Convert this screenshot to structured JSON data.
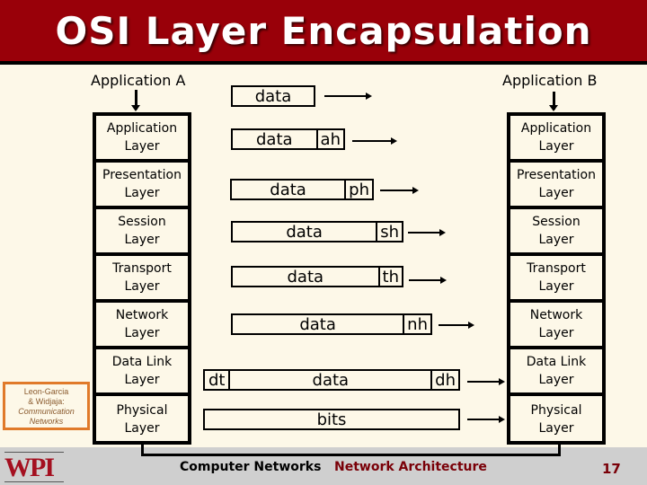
{
  "slide": {
    "title": "OSI Layer Encapsulation",
    "colors": {
      "title_bar": "#990009",
      "background": "#fdf8e8",
      "footer": "#cfcfcf",
      "credit_border": "#e07a2a",
      "accent_text": "#7a0008"
    }
  },
  "diagram": {
    "sender_label": "Application A",
    "receiver_label": "Application B",
    "layers": [
      {
        "line1": "Application",
        "line2": "Layer"
      },
      {
        "line1": "Presentation",
        "line2": "Layer"
      },
      {
        "line1": "Session",
        "line2": "Layer"
      },
      {
        "line1": "Transport",
        "line2": "Layer"
      },
      {
        "line1": "Network",
        "line2": "Layer"
      },
      {
        "line1": "Data Link",
        "line2": "Layer"
      },
      {
        "line1": "Physical",
        "line2": "Layer"
      }
    ],
    "pdus": [
      {
        "body": "data",
        "header": "",
        "trailer": ""
      },
      {
        "body": "data",
        "header": "ah",
        "trailer": ""
      },
      {
        "body": "data",
        "header": "ph",
        "trailer": ""
      },
      {
        "body": "data",
        "header": "sh",
        "trailer": ""
      },
      {
        "body": "data",
        "header": "th",
        "trailer": ""
      },
      {
        "body": "data",
        "header": "nh",
        "trailer": ""
      },
      {
        "body": "data",
        "header": "dh",
        "trailer": "dt"
      },
      {
        "body": "bits",
        "header": "",
        "trailer": ""
      }
    ]
  },
  "credit": {
    "line1": "Leon-Garcia",
    "line2": "& Widjaja:",
    "line3": "Communication",
    "line4": "Networks"
  },
  "footer": {
    "logo": "WPI",
    "course": "Computer Networks",
    "topic": "Network Architecture",
    "page_number": "17"
  }
}
